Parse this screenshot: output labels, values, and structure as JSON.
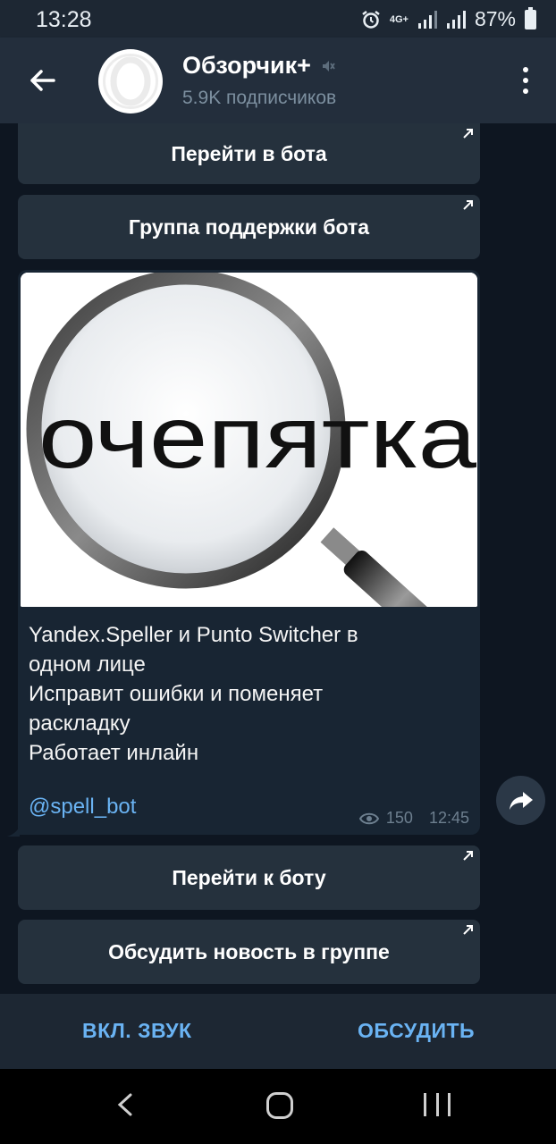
{
  "status_bar": {
    "time": "13:28",
    "network": "4G+",
    "battery": "87%"
  },
  "header": {
    "title": "Обзорчик+",
    "subscribers": "5.9K подписчиков",
    "avatar_letter": "O"
  },
  "buttons_top": [
    {
      "label": "Перейти в бота"
    },
    {
      "label": "Группа поддержки бота"
    }
  ],
  "message": {
    "image_text": "очепятка",
    "text_lines": [
      "Yandex.Speller и Punto Switcher в",
      "одном лице",
      "Исправит ошибки и поменяет",
      "раскладку",
      "Работает инлайн"
    ],
    "mention": "@spell_bot",
    "views": "150",
    "time": "12:45"
  },
  "buttons_bottom": [
    {
      "label": "Перейти к боту"
    },
    {
      "label": "Обсудить новость в группе"
    }
  ],
  "bottom_bar": {
    "unmute": "ВКЛ. ЗВУК",
    "discuss": "ОБСУДИТЬ"
  },
  "colors": {
    "header_bg": "#232e3c",
    "chat_bg": "#0e1621",
    "button_bg": "#25313d",
    "bubble_bg": "#182533",
    "accent": "#6ab3f3"
  }
}
